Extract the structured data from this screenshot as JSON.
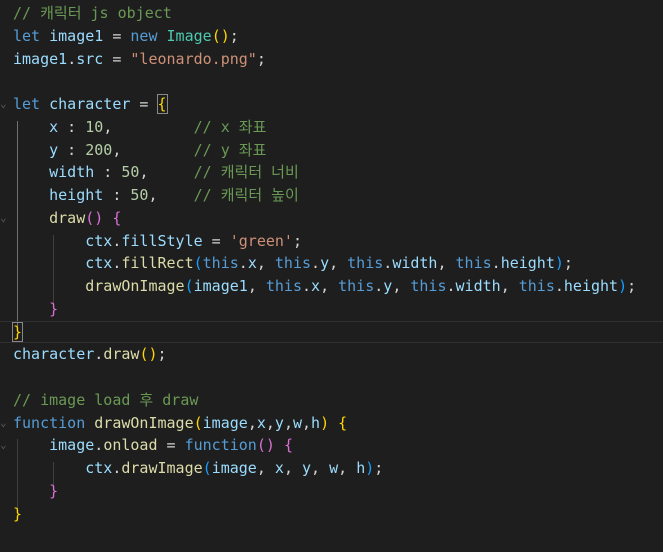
{
  "theme": {
    "background": "#1e1e1e",
    "comment": "#6a9955",
    "keyword": "#569cd6",
    "variable": "#9cdcfe",
    "function": "#dcdcaa",
    "class": "#4ec9b0",
    "string": "#ce9178",
    "number": "#b5cea8",
    "bracket_level1": "#ffd700",
    "bracket_level2": "#da70d6",
    "bracket_level3": "#179fff"
  },
  "highlighted_line": 11,
  "lines": [
    [
      {
        "t": "// 캐릭터 js object",
        "c": "comment"
      }
    ],
    [
      {
        "t": "let",
        "c": "kw"
      },
      {
        "t": " ",
        "c": "pl"
      },
      {
        "t": "image1",
        "c": "var"
      },
      {
        "t": " = ",
        "c": "pl"
      },
      {
        "t": "new",
        "c": "kw"
      },
      {
        "t": " ",
        "c": "pl"
      },
      {
        "t": "Image",
        "c": "cls"
      },
      {
        "t": "()",
        "c": "b1"
      },
      {
        "t": ";",
        "c": "pl"
      }
    ],
    [
      {
        "t": "image1",
        "c": "var"
      },
      {
        "t": ".",
        "c": "pl"
      },
      {
        "t": "src",
        "c": "var"
      },
      {
        "t": " = ",
        "c": "pl"
      },
      {
        "t": "\"leonardo.png\"",
        "c": "str"
      },
      {
        "t": ";",
        "c": "pl"
      }
    ],
    [],
    [
      {
        "t": "let",
        "c": "kw"
      },
      {
        "t": " ",
        "c": "pl"
      },
      {
        "t": "character",
        "c": "var"
      },
      {
        "t": " = ",
        "c": "pl"
      },
      {
        "t": "{",
        "c": "b1",
        "m": true
      }
    ],
    [
      {
        "t": "    ",
        "c": "pl"
      },
      {
        "t": "x",
        "c": "var"
      },
      {
        "t": " : ",
        "c": "pl"
      },
      {
        "t": "10",
        "c": "num"
      },
      {
        "t": ",         ",
        "c": "pl"
      },
      {
        "t": "// x 좌표",
        "c": "comment"
      }
    ],
    [
      {
        "t": "    ",
        "c": "pl"
      },
      {
        "t": "y",
        "c": "var"
      },
      {
        "t": " : ",
        "c": "pl"
      },
      {
        "t": "200",
        "c": "num"
      },
      {
        "t": ",        ",
        "c": "pl"
      },
      {
        "t": "// y 좌표",
        "c": "comment"
      }
    ],
    [
      {
        "t": "    ",
        "c": "pl"
      },
      {
        "t": "width",
        "c": "var"
      },
      {
        "t": " : ",
        "c": "pl"
      },
      {
        "t": "50",
        "c": "num"
      },
      {
        "t": ",     ",
        "c": "pl"
      },
      {
        "t": "// 캐릭터 너비",
        "c": "comment"
      }
    ],
    [
      {
        "t": "    ",
        "c": "pl"
      },
      {
        "t": "height",
        "c": "var"
      },
      {
        "t": " : ",
        "c": "pl"
      },
      {
        "t": "50",
        "c": "num"
      },
      {
        "t": ",    ",
        "c": "pl"
      },
      {
        "t": "// 캐릭터 높이",
        "c": "comment"
      }
    ],
    [
      {
        "t": "    ",
        "c": "pl"
      },
      {
        "t": "draw",
        "c": "fn"
      },
      {
        "t": "()",
        "c": "b2"
      },
      {
        "t": " ",
        "c": "pl"
      },
      {
        "t": "{",
        "c": "b2"
      }
    ],
    [
      {
        "t": "        ",
        "c": "pl"
      },
      {
        "t": "ctx",
        "c": "var"
      },
      {
        "t": ".",
        "c": "pl"
      },
      {
        "t": "fillStyle",
        "c": "var"
      },
      {
        "t": " = ",
        "c": "pl"
      },
      {
        "t": "'green'",
        "c": "str"
      },
      {
        "t": ";",
        "c": "pl"
      }
    ],
    [
      {
        "t": "        ",
        "c": "pl"
      },
      {
        "t": "ctx",
        "c": "var"
      },
      {
        "t": ".",
        "c": "pl"
      },
      {
        "t": "fillRect",
        "c": "fn"
      },
      {
        "t": "(",
        "c": "b3"
      },
      {
        "t": "this",
        "c": "kw"
      },
      {
        "t": ".",
        "c": "pl"
      },
      {
        "t": "x",
        "c": "var"
      },
      {
        "t": ", ",
        "c": "pl"
      },
      {
        "t": "this",
        "c": "kw"
      },
      {
        "t": ".",
        "c": "pl"
      },
      {
        "t": "y",
        "c": "var"
      },
      {
        "t": ", ",
        "c": "pl"
      },
      {
        "t": "this",
        "c": "kw"
      },
      {
        "t": ".",
        "c": "pl"
      },
      {
        "t": "width",
        "c": "var"
      },
      {
        "t": ", ",
        "c": "pl"
      },
      {
        "t": "this",
        "c": "kw"
      },
      {
        "t": ".",
        "c": "pl"
      },
      {
        "t": "height",
        "c": "var"
      },
      {
        "t": ")",
        "c": "b3"
      },
      {
        "t": ";",
        "c": "pl"
      }
    ],
    [
      {
        "t": "        ",
        "c": "pl"
      },
      {
        "t": "drawOnImage",
        "c": "fn"
      },
      {
        "t": "(",
        "c": "b3"
      },
      {
        "t": "image1",
        "c": "var"
      },
      {
        "t": ", ",
        "c": "pl"
      },
      {
        "t": "this",
        "c": "kw"
      },
      {
        "t": ".",
        "c": "pl"
      },
      {
        "t": "x",
        "c": "var"
      },
      {
        "t": ", ",
        "c": "pl"
      },
      {
        "t": "this",
        "c": "kw"
      },
      {
        "t": ".",
        "c": "pl"
      },
      {
        "t": "y",
        "c": "var"
      },
      {
        "t": ", ",
        "c": "pl"
      },
      {
        "t": "this",
        "c": "kw"
      },
      {
        "t": ".",
        "c": "pl"
      },
      {
        "t": "width",
        "c": "var"
      },
      {
        "t": ", ",
        "c": "pl"
      },
      {
        "t": "this",
        "c": "kw"
      },
      {
        "t": ".",
        "c": "pl"
      },
      {
        "t": "height",
        "c": "var"
      },
      {
        "t": ")",
        "c": "b3"
      },
      {
        "t": ";",
        "c": "pl"
      }
    ],
    [
      {
        "t": "    ",
        "c": "pl"
      },
      {
        "t": "}",
        "c": "b2"
      }
    ],
    [
      {
        "t": "}",
        "c": "b1",
        "m": true
      }
    ],
    [
      {
        "t": "character",
        "c": "var"
      },
      {
        "t": ".",
        "c": "pl"
      },
      {
        "t": "draw",
        "c": "fn"
      },
      {
        "t": "()",
        "c": "b1"
      },
      {
        "t": ";",
        "c": "pl"
      }
    ],
    [],
    [
      {
        "t": "// image load 후 draw",
        "c": "comment"
      }
    ],
    [
      {
        "t": "function",
        "c": "kw"
      },
      {
        "t": " ",
        "c": "pl"
      },
      {
        "t": "drawOnImage",
        "c": "fn"
      },
      {
        "t": "(",
        "c": "b1"
      },
      {
        "t": "image",
        "c": "var"
      },
      {
        "t": ",",
        "c": "pl"
      },
      {
        "t": "x",
        "c": "var"
      },
      {
        "t": ",",
        "c": "pl"
      },
      {
        "t": "y",
        "c": "var"
      },
      {
        "t": ",",
        "c": "pl"
      },
      {
        "t": "w",
        "c": "var"
      },
      {
        "t": ",",
        "c": "pl"
      },
      {
        "t": "h",
        "c": "var"
      },
      {
        "t": ")",
        "c": "b1"
      },
      {
        "t": " ",
        "c": "pl"
      },
      {
        "t": "{",
        "c": "b1"
      }
    ],
    [
      {
        "t": "    ",
        "c": "pl"
      },
      {
        "t": "image",
        "c": "var"
      },
      {
        "t": ".",
        "c": "pl"
      },
      {
        "t": "onload",
        "c": "fn"
      },
      {
        "t": " = ",
        "c": "pl"
      },
      {
        "t": "function",
        "c": "kw"
      },
      {
        "t": "()",
        "c": "b2"
      },
      {
        "t": " ",
        "c": "pl"
      },
      {
        "t": "{",
        "c": "b2"
      }
    ],
    [
      {
        "t": "        ",
        "c": "pl"
      },
      {
        "t": "ctx",
        "c": "var"
      },
      {
        "t": ".",
        "c": "pl"
      },
      {
        "t": "drawImage",
        "c": "fn"
      },
      {
        "t": "(",
        "c": "b3"
      },
      {
        "t": "image",
        "c": "var"
      },
      {
        "t": ", ",
        "c": "pl"
      },
      {
        "t": "x",
        "c": "var"
      },
      {
        "t": ", ",
        "c": "pl"
      },
      {
        "t": "y",
        "c": "var"
      },
      {
        "t": ", ",
        "c": "pl"
      },
      {
        "t": "w",
        "c": "var"
      },
      {
        "t": ", ",
        "c": "pl"
      },
      {
        "t": "h",
        "c": "var"
      },
      {
        "t": ")",
        "c": "b3"
      },
      {
        "t": ";",
        "c": "pl"
      }
    ],
    [
      {
        "t": "    ",
        "c": "pl"
      },
      {
        "t": "}",
        "c": "b2"
      }
    ],
    [
      {
        "t": "}",
        "c": "b1"
      }
    ]
  ]
}
